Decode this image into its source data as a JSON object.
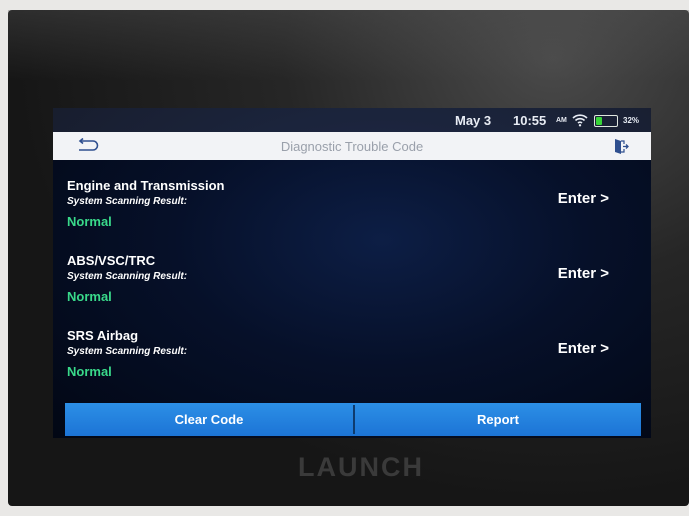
{
  "status_bar": {
    "date": "May 3",
    "time": "10:55",
    "am_pm": "AM",
    "battery_percent": "32%",
    "battery_level": 0.32,
    "battery_color": "#38d538"
  },
  "header": {
    "title": "Diagnostic Trouble Code",
    "back_icon": "back-arrow-icon",
    "exit_icon": "exit-icon"
  },
  "systems": [
    {
      "name": "Engine and Transmission",
      "result_label": "System Scanning Result:",
      "result": "Normal",
      "action": "Enter >"
    },
    {
      "name": "ABS/VSC/TRC",
      "result_label": "System Scanning Result:",
      "result": "Normal",
      "action": "Enter >"
    },
    {
      "name": "SRS Airbag",
      "result_label": "System Scanning Result:",
      "result": "Normal",
      "action": "Enter >"
    }
  ],
  "footer": {
    "clear_code": "Clear Code",
    "report": "Report"
  },
  "device": {
    "brand": "LAUNCH"
  },
  "colors": {
    "normal_status": "#39d98a",
    "button_blue": "#1c74d6"
  }
}
